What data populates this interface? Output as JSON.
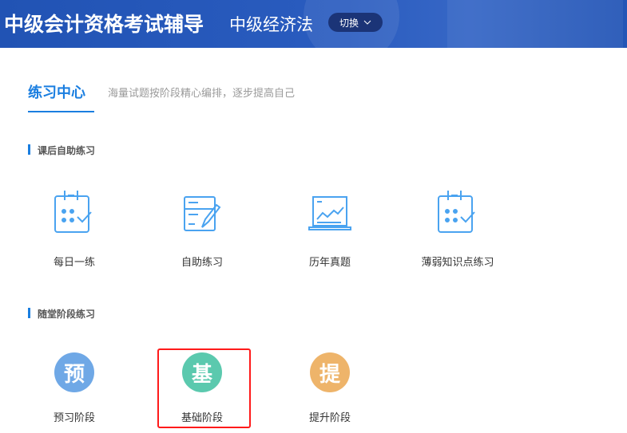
{
  "header": {
    "title": "中级会计资格考试辅导",
    "subject": "中级经济法",
    "switch_label": "切换",
    "bg_color": "#2255b5"
  },
  "tab": {
    "label": "练习中心",
    "subtitle": "海量试题按阶段精心编排，逐步提高自己",
    "accent": "#1a7ee0"
  },
  "section1": {
    "title": "课后自助练习",
    "items": [
      {
        "label": "每日一练",
        "icon": "calendar-check-icon"
      },
      {
        "label": "自助练习",
        "icon": "form-pen-icon"
      },
      {
        "label": "历年真题",
        "icon": "laptop-chart-icon"
      },
      {
        "label": "薄弱知识点练习",
        "icon": "calendar-check-icon"
      }
    ]
  },
  "section2": {
    "title": "随堂阶段练习",
    "items": [
      {
        "label": "预习阶段",
        "glyph": "预",
        "color": "#6fa8e6"
      },
      {
        "label": "基础阶段",
        "glyph": "基",
        "color": "#5bc9ae"
      },
      {
        "label": "提升阶段",
        "glyph": "提",
        "color": "#eeb46a"
      }
    ]
  }
}
